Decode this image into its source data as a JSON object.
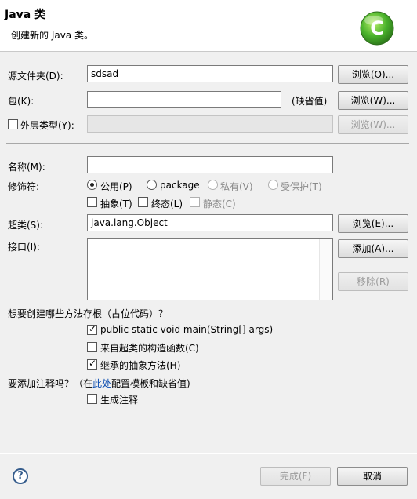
{
  "header": {
    "title": "Java 类",
    "subtitle": "创建新的 Java 类。",
    "logo_letter": "C"
  },
  "source_folder": {
    "label": "源文件夹(D):",
    "value": "sdsad",
    "browse": "浏览(O)..."
  },
  "package": {
    "label": "包(K):",
    "value": "",
    "default_hint": "(缺省值)",
    "browse": "浏览(W)..."
  },
  "enclosing_type": {
    "label": "外层类型(Y):",
    "checked": false,
    "value": "",
    "browse": "浏览(W)..."
  },
  "name": {
    "label": "名称(M):",
    "value": ""
  },
  "modifiers": {
    "label": "修饰符:",
    "public": "公用(P)",
    "package": "package",
    "private": "私有(V)",
    "protected": "受保护(T)",
    "abstract": "抽象(T)",
    "final": "终态(L)",
    "static": "静态(C)",
    "selected": "public"
  },
  "superclass": {
    "label": "超类(S):",
    "value": "java.lang.Object",
    "browse": "浏览(E)..."
  },
  "interfaces": {
    "label": "接口(I):",
    "add": "添加(A)...",
    "remove": "移除(R)"
  },
  "stubs": {
    "question": "想要创建哪些方法存根（占位代码）？",
    "main": "public static void main(String[] args)",
    "main_checked": true,
    "constructors": "来自超类的构造函数(C)",
    "constructors_checked": false,
    "inherited": "继承的抽象方法(H)",
    "inherited_checked": true
  },
  "comments": {
    "question_prefix": "要添加注释吗？（在",
    "link": "此处",
    "question_suffix": "配置模板和缺省值)",
    "generate": "生成注释",
    "generate_checked": false
  },
  "footer": {
    "help_glyph": "?",
    "finish": "完成(F)",
    "cancel": "取消"
  },
  "colors": {
    "logo_green": "#3fa52a",
    "link": "#0a4cb0"
  }
}
